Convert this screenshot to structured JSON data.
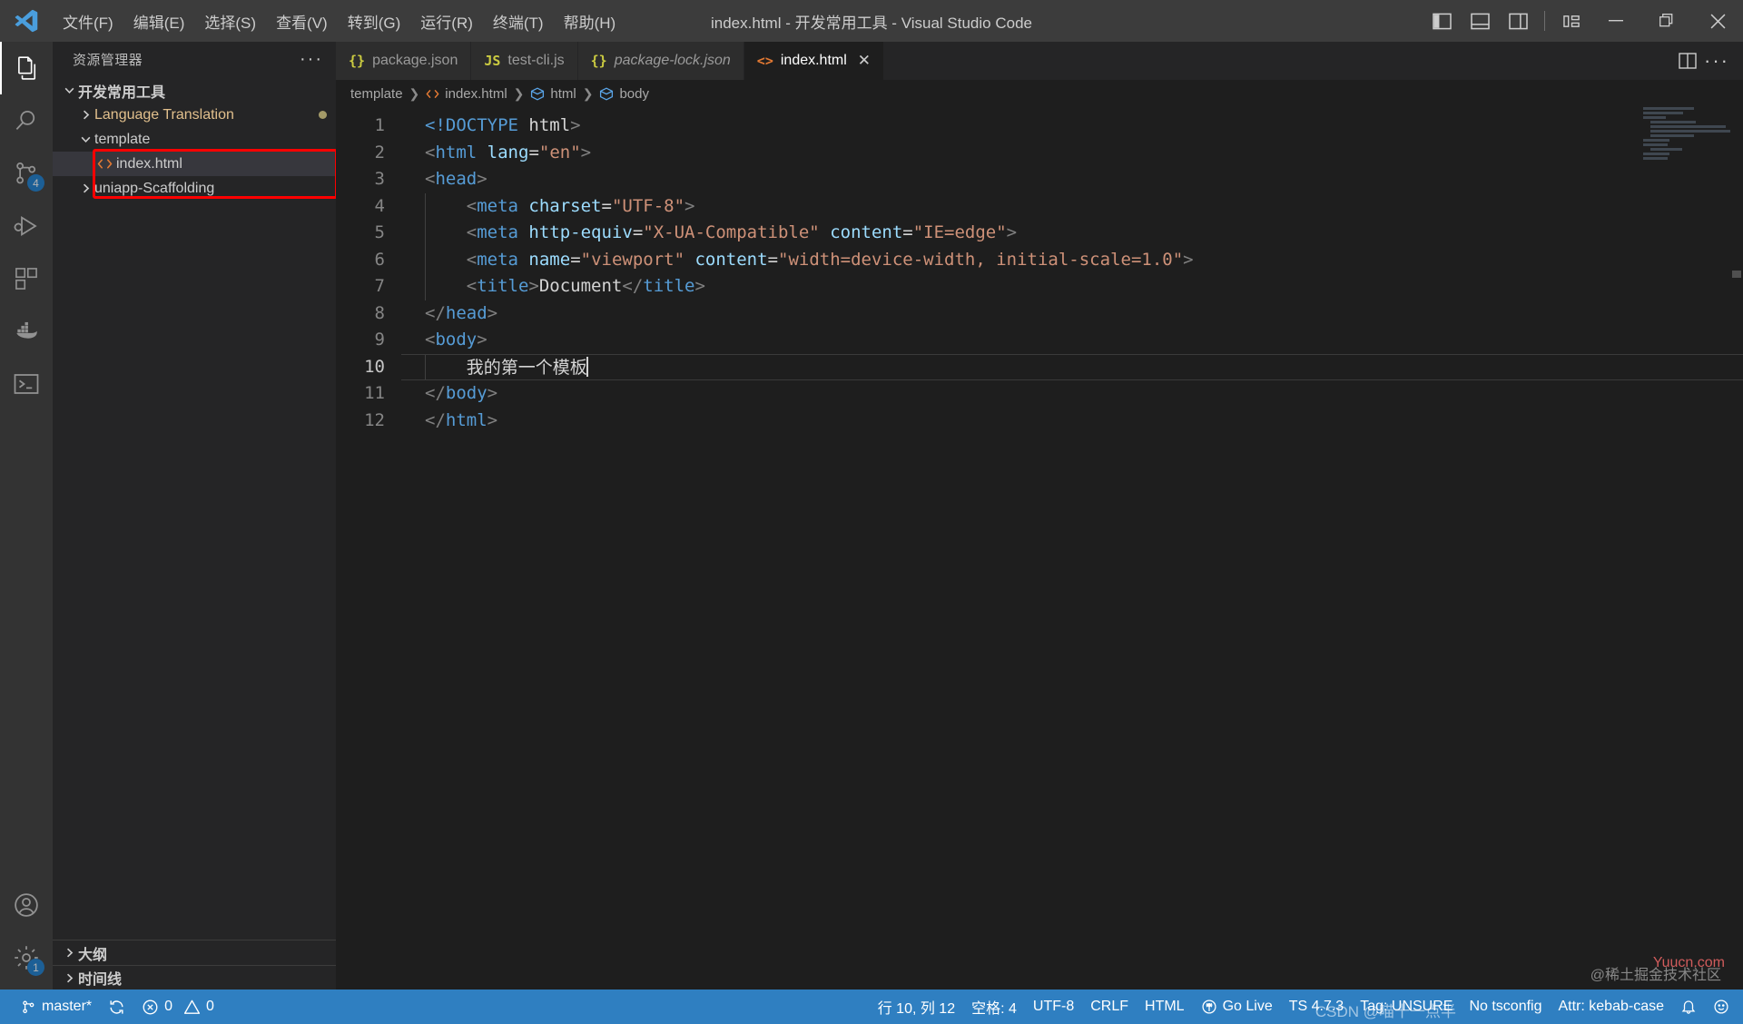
{
  "window": {
    "title": "index.html - 开发常用工具 - Visual Studio Code",
    "logo_name": "vscode-logo"
  },
  "menu": {
    "items": [
      {
        "label": "文件(F)"
      },
      {
        "label": "编辑(E)"
      },
      {
        "label": "选择(S)"
      },
      {
        "label": "查看(V)"
      },
      {
        "label": "转到(G)"
      },
      {
        "label": "运行(R)"
      },
      {
        "label": "终端(T)"
      },
      {
        "label": "帮助(H)"
      }
    ]
  },
  "titlebar_actions": {
    "toggle_primary_sidebar": "toggle-primary-sidebar",
    "toggle_panel": "toggle-panel",
    "toggle_secondary_sidebar": "toggle-secondary-sidebar",
    "customize_layout": "customize-layout"
  },
  "window_controls": {
    "minimize": "minimize",
    "restore": "restore",
    "close": "close"
  },
  "activitybar": {
    "items": [
      {
        "name": "explorer",
        "icon": "files-icon",
        "active": true,
        "badge": ""
      },
      {
        "name": "search",
        "icon": "search-icon",
        "active": false,
        "badge": ""
      },
      {
        "name": "source-control",
        "icon": "source-control-icon",
        "active": false,
        "badge": "4"
      },
      {
        "name": "run-and-debug",
        "icon": "run-debug-icon",
        "active": false,
        "badge": ""
      },
      {
        "name": "extensions",
        "icon": "extensions-icon",
        "active": false,
        "badge": ""
      },
      {
        "name": "docker",
        "icon": "docker-icon",
        "active": false,
        "badge": ""
      },
      {
        "name": "remote-terminal",
        "icon": "terminal-icon",
        "active": false,
        "badge": ""
      }
    ],
    "bottom_items": [
      {
        "name": "accounts",
        "icon": "account-icon",
        "badge": ""
      },
      {
        "name": "manage-settings",
        "icon": "gear-icon",
        "badge": "1"
      }
    ]
  },
  "sidebar": {
    "header_title": "资源管理器",
    "more_actions": "···",
    "tree": [
      {
        "label": "开发常用工具",
        "depth": 0,
        "type": "folder",
        "expanded": true,
        "bold": true,
        "selected": false,
        "dirty": false,
        "color": "#cccccc"
      },
      {
        "label": "Language Translation",
        "depth": 1,
        "type": "folder",
        "expanded": false,
        "bold": false,
        "selected": false,
        "dirty": true,
        "color": "#e2c08d"
      },
      {
        "label": "template",
        "depth": 1,
        "type": "folder",
        "expanded": true,
        "bold": false,
        "selected": false,
        "dirty": false,
        "color": "#cccccc"
      },
      {
        "label": "index.html",
        "depth": 2,
        "type": "html-file",
        "expanded": false,
        "bold": false,
        "selected": true,
        "dirty": false,
        "color": "#cccccc"
      },
      {
        "label": "uniapp-Scaffolding",
        "depth": 1,
        "type": "folder",
        "expanded": false,
        "bold": false,
        "selected": false,
        "dirty": false,
        "color": "#cccccc"
      }
    ],
    "bottom_panels": [
      {
        "label": "大纲"
      },
      {
        "label": "时间线"
      }
    ]
  },
  "annotation": {
    "color": "#ff0000",
    "label": "highlight-template-index-html"
  },
  "tabs": [
    {
      "label": "package.json",
      "icon": "json-icon",
      "icon_glyph": "{}",
      "icon_color": "#cbcb41",
      "active": false,
      "preview": false,
      "closable": false
    },
    {
      "label": "test-cli.js",
      "icon": "js-icon",
      "icon_glyph": "JS",
      "icon_color": "#cbcb41",
      "active": false,
      "preview": false,
      "closable": false
    },
    {
      "label": "package-lock.json",
      "icon": "json-icon",
      "icon_glyph": "{}",
      "icon_color": "#cbcb41",
      "active": false,
      "preview": true,
      "closable": false
    },
    {
      "label": "index.html",
      "icon": "html-icon",
      "icon_glyph": "<>",
      "icon_color": "#e37933",
      "active": true,
      "preview": false,
      "closable": true,
      "close_glyph": "✕"
    }
  ],
  "editor_actions": {
    "split_editor": "split-editor-icon",
    "more_actions": "more-actions-icon"
  },
  "breadcrumb": [
    {
      "label": "template",
      "icon": ""
    },
    {
      "label": "index.html",
      "icon": "html-icon"
    },
    {
      "label": "html",
      "icon": "symbol-field-icon"
    },
    {
      "label": "body",
      "icon": "symbol-field-icon"
    }
  ],
  "code": {
    "language": "html",
    "active_line": 10,
    "lines": [
      {
        "n": 1,
        "tokens": [
          {
            "t": "<!DOCTYPE ",
            "c": "tk-tag"
          },
          {
            "t": "html",
            "c": "tk-txt"
          },
          {
            "t": ">",
            "c": "tk-brk"
          }
        ]
      },
      {
        "n": 2,
        "tokens": [
          {
            "t": "<",
            "c": "tk-brk"
          },
          {
            "t": "html",
            "c": "tk-tag"
          },
          {
            "t": " ",
            "c": "tk-txt"
          },
          {
            "t": "lang",
            "c": "tk-attr"
          },
          {
            "t": "=",
            "c": "tk-eq"
          },
          {
            "t": "\"en\"",
            "c": "tk-str"
          },
          {
            "t": ">",
            "c": "tk-brk"
          }
        ]
      },
      {
        "n": 3,
        "tokens": [
          {
            "t": "<",
            "c": "tk-brk"
          },
          {
            "t": "head",
            "c": "tk-tag"
          },
          {
            "t": ">",
            "c": "tk-brk"
          }
        ]
      },
      {
        "n": 4,
        "indent": 1,
        "tokens": [
          {
            "t": "    <",
            "c": "tk-brk"
          },
          {
            "t": "meta",
            "c": "tk-tag"
          },
          {
            "t": " ",
            "c": "tk-txt"
          },
          {
            "t": "charset",
            "c": "tk-attr"
          },
          {
            "t": "=",
            "c": "tk-eq"
          },
          {
            "t": "\"UTF-8\"",
            "c": "tk-str"
          },
          {
            "t": ">",
            "c": "tk-brk"
          }
        ]
      },
      {
        "n": 5,
        "indent": 1,
        "tokens": [
          {
            "t": "    <",
            "c": "tk-brk"
          },
          {
            "t": "meta",
            "c": "tk-tag"
          },
          {
            "t": " ",
            "c": "tk-txt"
          },
          {
            "t": "http-equiv",
            "c": "tk-attr"
          },
          {
            "t": "=",
            "c": "tk-eq"
          },
          {
            "t": "\"X-UA-Compatible\"",
            "c": "tk-str"
          },
          {
            "t": " ",
            "c": "tk-txt"
          },
          {
            "t": "content",
            "c": "tk-attr"
          },
          {
            "t": "=",
            "c": "tk-eq"
          },
          {
            "t": "\"IE=edge\"",
            "c": "tk-str"
          },
          {
            "t": ">",
            "c": "tk-brk"
          }
        ]
      },
      {
        "n": 6,
        "indent": 1,
        "tokens": [
          {
            "t": "    <",
            "c": "tk-brk"
          },
          {
            "t": "meta",
            "c": "tk-tag"
          },
          {
            "t": " ",
            "c": "tk-txt"
          },
          {
            "t": "name",
            "c": "tk-attr"
          },
          {
            "t": "=",
            "c": "tk-eq"
          },
          {
            "t": "\"viewport\"",
            "c": "tk-str"
          },
          {
            "t": " ",
            "c": "tk-txt"
          },
          {
            "t": "content",
            "c": "tk-attr"
          },
          {
            "t": "=",
            "c": "tk-eq"
          },
          {
            "t": "\"width=device-width, initial-scale=1.0\"",
            "c": "tk-str"
          },
          {
            "t": ">",
            "c": "tk-brk"
          }
        ]
      },
      {
        "n": 7,
        "indent": 1,
        "tokens": [
          {
            "t": "    <",
            "c": "tk-brk"
          },
          {
            "t": "title",
            "c": "tk-tag"
          },
          {
            "t": ">",
            "c": "tk-brk"
          },
          {
            "t": "Document",
            "c": "tk-txt"
          },
          {
            "t": "</",
            "c": "tk-brk"
          },
          {
            "t": "title",
            "c": "tk-tag"
          },
          {
            "t": ">",
            "c": "tk-brk"
          }
        ]
      },
      {
        "n": 8,
        "tokens": [
          {
            "t": "</",
            "c": "tk-brk"
          },
          {
            "t": "head",
            "c": "tk-tag"
          },
          {
            "t": ">",
            "c": "tk-brk"
          }
        ]
      },
      {
        "n": 9,
        "tokens": [
          {
            "t": "<",
            "c": "tk-brk"
          },
          {
            "t": "body",
            "c": "tk-tag"
          },
          {
            "t": ">",
            "c": "tk-brk"
          }
        ]
      },
      {
        "n": 10,
        "indent": 1,
        "active": true,
        "tokens": [
          {
            "t": "    ",
            "c": "tk-txt"
          },
          {
            "t": "我的第一个模板",
            "c": "tk-cjk"
          }
        ]
      },
      {
        "n": 11,
        "tokens": [
          {
            "t": "</",
            "c": "tk-brk"
          },
          {
            "t": "body",
            "c": "tk-tag"
          },
          {
            "t": ">",
            "c": "tk-brk"
          }
        ]
      },
      {
        "n": 12,
        "tokens": [
          {
            "t": "</",
            "c": "tk-brk"
          },
          {
            "t": "html",
            "c": "tk-tag"
          },
          {
            "t": ">",
            "c": "tk-brk"
          }
        ]
      }
    ]
  },
  "statusbar": {
    "background": "#2f7fc1",
    "left": [
      {
        "name": "git-branch",
        "icon": "source-control-icon",
        "label": "master*"
      },
      {
        "name": "sync-changes",
        "icon": "sync-icon",
        "label": ""
      },
      {
        "name": "problems",
        "icon": "error-warning-icons",
        "label": "0  0",
        "errors": "0",
        "warnings": "0"
      }
    ],
    "right": [
      {
        "name": "cursor-position",
        "icon": "",
        "label": "行 10, 列 12"
      },
      {
        "name": "indentation",
        "icon": "",
        "label": "空格: 4"
      },
      {
        "name": "encoding",
        "icon": "",
        "label": "UTF-8"
      },
      {
        "name": "eol",
        "icon": "",
        "label": "CRLF"
      },
      {
        "name": "language-mode",
        "icon": "",
        "label": "HTML"
      },
      {
        "name": "go-live",
        "icon": "broadcast-icon",
        "label": "Go Live"
      },
      {
        "name": "typescript-version",
        "icon": "",
        "label": "TS 4.7.3"
      },
      {
        "name": "tag-status",
        "icon": "",
        "label": "Tag: UNSURE"
      },
      {
        "name": "tsconfig-status",
        "icon": "",
        "label": "No tsconfig"
      },
      {
        "name": "attr-case",
        "icon": "",
        "label": "Attr: kebab-case"
      },
      {
        "name": "notifications",
        "icon": "bell-icon",
        "label": ""
      },
      {
        "name": "feedback",
        "icon": "smiley-icon",
        "label": ""
      }
    ]
  },
  "watermarks": {
    "bottom_right": "@稀土掘金技术社区",
    "overlay": "CSDN @喵十一点半",
    "brand": "Yuucn.com"
  }
}
